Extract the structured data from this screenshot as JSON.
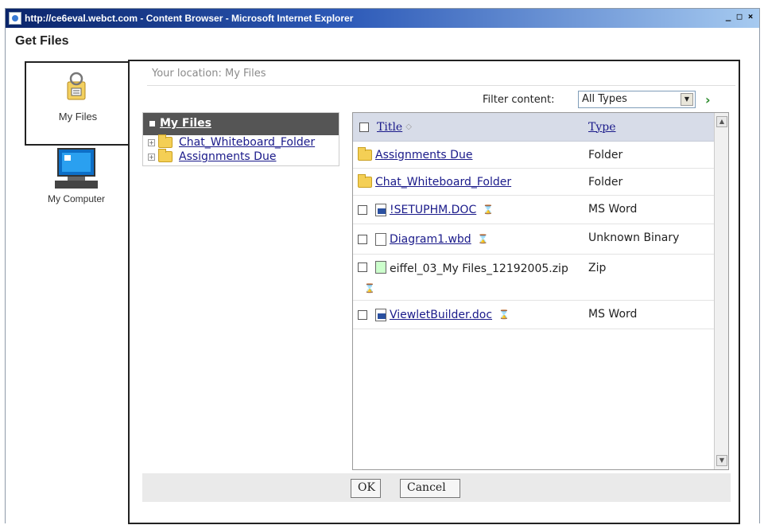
{
  "window": {
    "title": "http://ce6eval.webct.com - Content Browser - Microsoft Internet Explorer",
    "controls": [
      "_",
      "□",
      "×"
    ]
  },
  "page": {
    "heading": "Get Files"
  },
  "nav": {
    "my_files_label": "My Files",
    "my_computer_label": "My Computer"
  },
  "location": {
    "text": "Your location: My Files"
  },
  "filter": {
    "label": "Filter content:",
    "selected": "All Types"
  },
  "tree": {
    "root": "My Files",
    "items": [
      {
        "label": "Chat_Whiteboard_Folder"
      },
      {
        "label": "Assignments Due"
      }
    ]
  },
  "files": {
    "columns": {
      "title": "Title",
      "type": "Type"
    },
    "rows": [
      {
        "name": "Assignments Due",
        "type": "Folder"
      },
      {
        "name": "Chat_Whiteboard_Folder",
        "type": "Folder"
      },
      {
        "name": "!SETUPHM.DOC",
        "type": "MS Word"
      },
      {
        "name": "Diagram1.wbd",
        "type": "Unknown Binary"
      },
      {
        "name": "eiffel_03_My Files_12192005.zip",
        "type": "Zip"
      },
      {
        "name": "ViewletBuilder.doc",
        "type": "MS Word"
      }
    ]
  },
  "buttons": {
    "ok": "OK",
    "cancel": "Cancel"
  }
}
